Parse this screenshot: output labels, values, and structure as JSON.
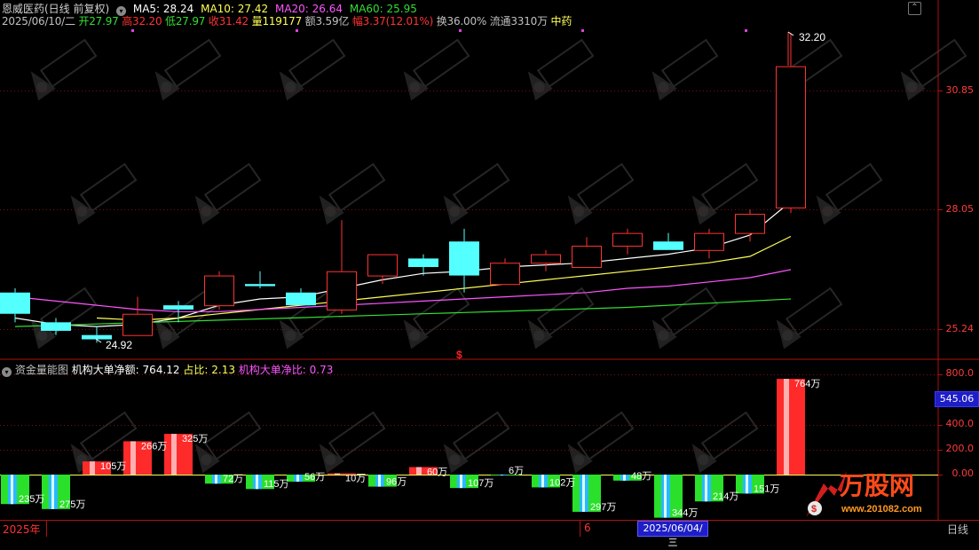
{
  "header": {
    "stock_name": "恩威医药(日线 前复权)",
    "ma5_label": "MA5: 28.24",
    "ma10_label": "MA10: 27.42",
    "ma20_label": "MA20: 26.64",
    "ma60_label": "MA60: 25.95"
  },
  "quote": {
    "date": "2025/06/10/二",
    "open_label": "开",
    "open": "27.97",
    "high_label": "高",
    "high": "32.20",
    "low_label": "低",
    "low": "27.97",
    "close_label": "收",
    "close": "31.42",
    "vol_label": "量",
    "vol": "119177",
    "amt_label": "额",
    "amt": "3.59亿",
    "chg_label": "幅",
    "chg": "3.37(12.01%)",
    "turn_label": "换",
    "turn": "36.00%",
    "float_label": "流通",
    "float": "3310万",
    "sector": "中药"
  },
  "price_axis": [
    "30.85",
    "28.05",
    "25.24"
  ],
  "annotations": {
    "high_marker": "32.20",
    "low_marker": "24.92",
    "dollar_marker": "$"
  },
  "sub_panel": {
    "title": "资金量能图",
    "metric1_label": "机构大单净额:",
    "metric1_value": "764.12",
    "metric2_label": "占比:",
    "metric2_value": "2.13",
    "metric3_label": "机构大单净比:",
    "metric3_value": "0.73",
    "axis": [
      "800.0",
      "400.0",
      "200.0",
      "0.00"
    ],
    "axis_highlight": "545.06"
  },
  "footer": {
    "year": "2025年",
    "month": "6",
    "cursor_date": "2025/06/04/三",
    "period": "日线"
  },
  "watermark": {
    "brand": "万股网",
    "url": "www.201082.com"
  },
  "colors": {
    "up": "#ff3232",
    "down": "#54ffff",
    "ma5": "#ffffff",
    "ma10": "#ffff55",
    "ma20": "#ff55ff",
    "ma60": "#33dd33"
  },
  "chart_data": [
    {
      "type": "candlestick",
      "title": "恩威医药(日线 前复权)",
      "y_ticks": [
        25.24,
        28.05,
        30.85
      ],
      "candles": [
        {
          "open": 26.1,
          "close": 25.6,
          "high": 26.2,
          "low": 25.4
        },
        {
          "open": 25.4,
          "close": 25.2,
          "high": 25.5,
          "low": 25.1
        },
        {
          "open": 25.1,
          "close": 25.0,
          "high": 25.3,
          "low": 24.92
        },
        {
          "open": 25.1,
          "close": 25.6,
          "high": 26.0,
          "low": 25.1
        },
        {
          "open": 25.8,
          "close": 25.7,
          "high": 25.9,
          "low": 25.4
        },
        {
          "open": 25.8,
          "close": 26.5,
          "high": 26.6,
          "low": 25.7
        },
        {
          "open": 26.3,
          "close": 26.25,
          "high": 26.6,
          "low": 26.2
        },
        {
          "open": 26.1,
          "close": 25.8,
          "high": 26.2,
          "low": 25.8
        },
        {
          "open": 25.7,
          "close": 26.6,
          "high": 27.8,
          "low": 25.6
        },
        {
          "open": 26.5,
          "close": 27.0,
          "high": 27.0,
          "low": 26.3
        },
        {
          "open": 26.9,
          "close": 26.7,
          "high": 27.0,
          "low": 26.5
        },
        {
          "open": 27.3,
          "close": 26.5,
          "high": 27.6,
          "low": 26.1
        },
        {
          "open": 26.3,
          "close": 26.8,
          "high": 26.9,
          "low": 26.3
        },
        {
          "open": 26.8,
          "close": 27.0,
          "high": 27.1,
          "low": 26.6
        },
        {
          "open": 26.7,
          "close": 27.2,
          "high": 27.4,
          "low": 26.7
        },
        {
          "open": 27.2,
          "close": 27.5,
          "high": 27.6,
          "low": 27.0
        },
        {
          "open": 27.3,
          "close": 27.1,
          "high": 27.5,
          "low": 27.1
        },
        {
          "open": 27.1,
          "close": 27.5,
          "high": 27.6,
          "low": 26.9
        },
        {
          "open": 27.5,
          "close": 27.95,
          "high": 28.05,
          "low": 27.3
        },
        {
          "open": 28.1,
          "close": 31.42,
          "high": 32.2,
          "low": 27.97
        }
      ],
      "series": [
        {
          "name": "MA5",
          "values": [
            25.5,
            25.35,
            25.3,
            25.35,
            25.5,
            25.8,
            25.95,
            26.0,
            26.2,
            26.4,
            26.55,
            26.6,
            26.7,
            26.75,
            26.8,
            26.9,
            27.0,
            27.15,
            27.45,
            28.24
          ]
        },
        {
          "name": "MA10",
          "values": [
            null,
            null,
            25.5,
            25.45,
            25.5,
            25.6,
            25.7,
            25.8,
            25.9,
            26.0,
            26.1,
            26.2,
            26.3,
            26.4,
            26.5,
            26.6,
            26.7,
            26.8,
            26.95,
            27.42
          ]
        },
        {
          "name": "MA20",
          "values": [
            26.0,
            25.9,
            25.8,
            25.7,
            25.65,
            25.65,
            25.7,
            25.75,
            25.8,
            25.85,
            25.9,
            25.95,
            26.0,
            26.05,
            26.1,
            26.2,
            26.25,
            26.35,
            26.45,
            26.64
          ]
        },
        {
          "name": "MA60",
          "values": [
            25.3,
            25.33,
            25.36,
            25.39,
            25.42,
            25.45,
            25.48,
            25.51,
            25.54,
            25.57,
            25.6,
            25.63,
            25.66,
            25.69,
            25.72,
            25.75,
            25.8,
            25.85,
            25.9,
            25.95
          ]
        }
      ]
    },
    {
      "type": "bar",
      "title": "资金量能图",
      "y_ticks": [
        0,
        200,
        400,
        800
      ],
      "ylim": [
        -420,
        820
      ],
      "values": [
        -235,
        -275,
        105,
        266,
        325,
        -72,
        -115,
        -56,
        10,
        -96,
        60,
        -107,
        -6,
        -102,
        -297,
        -48,
        -344,
        -214,
        -151,
        764
      ],
      "labels": [
        "235万",
        "275万",
        "105万",
        "266万",
        "325万",
        "72万",
        "115万",
        "56万",
        "10万",
        "96万",
        "60万",
        "107万",
        "6万",
        "102万",
        "297万",
        "48万",
        "344万",
        "214万",
        "151万",
        "764万"
      ]
    }
  ]
}
